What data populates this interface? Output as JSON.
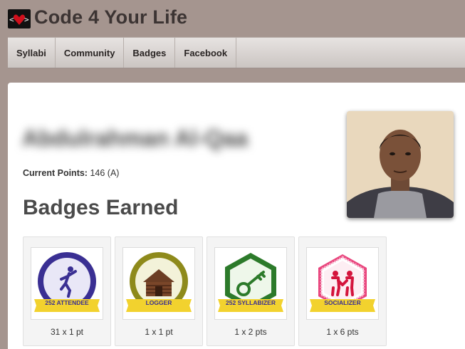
{
  "site": {
    "title": "Code 4 Your Life",
    "logo_icon": "heart-code-icon"
  },
  "nav": {
    "items": [
      {
        "label": "Syllabi"
      },
      {
        "label": "Community"
      },
      {
        "label": "Badges"
      },
      {
        "label": "Facebook"
      }
    ]
  },
  "profile": {
    "name": "Abdulrahman Al-Qaa",
    "points_label": "Current Points:",
    "points_value": "146 (A)",
    "avatar_icon": "profile-photo"
  },
  "badges": {
    "heading": "Badges Earned",
    "items": [
      {
        "label": "252 ATTENDEE",
        "count": "31 x 1 pt",
        "icon": "jumping-person-icon",
        "color": "#3a2f93"
      },
      {
        "label": "LOGGER",
        "count": "1 x 1 pt",
        "icon": "log-cabin-icon",
        "color": "#8e8a1b"
      },
      {
        "label": "252 SYLLABIZER",
        "count": "1 x 2 pts",
        "icon": "key-icon",
        "color": "#2c7a2a"
      },
      {
        "label": "SOCIALIZER",
        "count": "1 x 6 pts",
        "icon": "two-people-icon",
        "color": "#e8447c"
      }
    ]
  },
  "colors": {
    "page_bg": "#a5958f",
    "ribbon": "#f2d22e"
  }
}
